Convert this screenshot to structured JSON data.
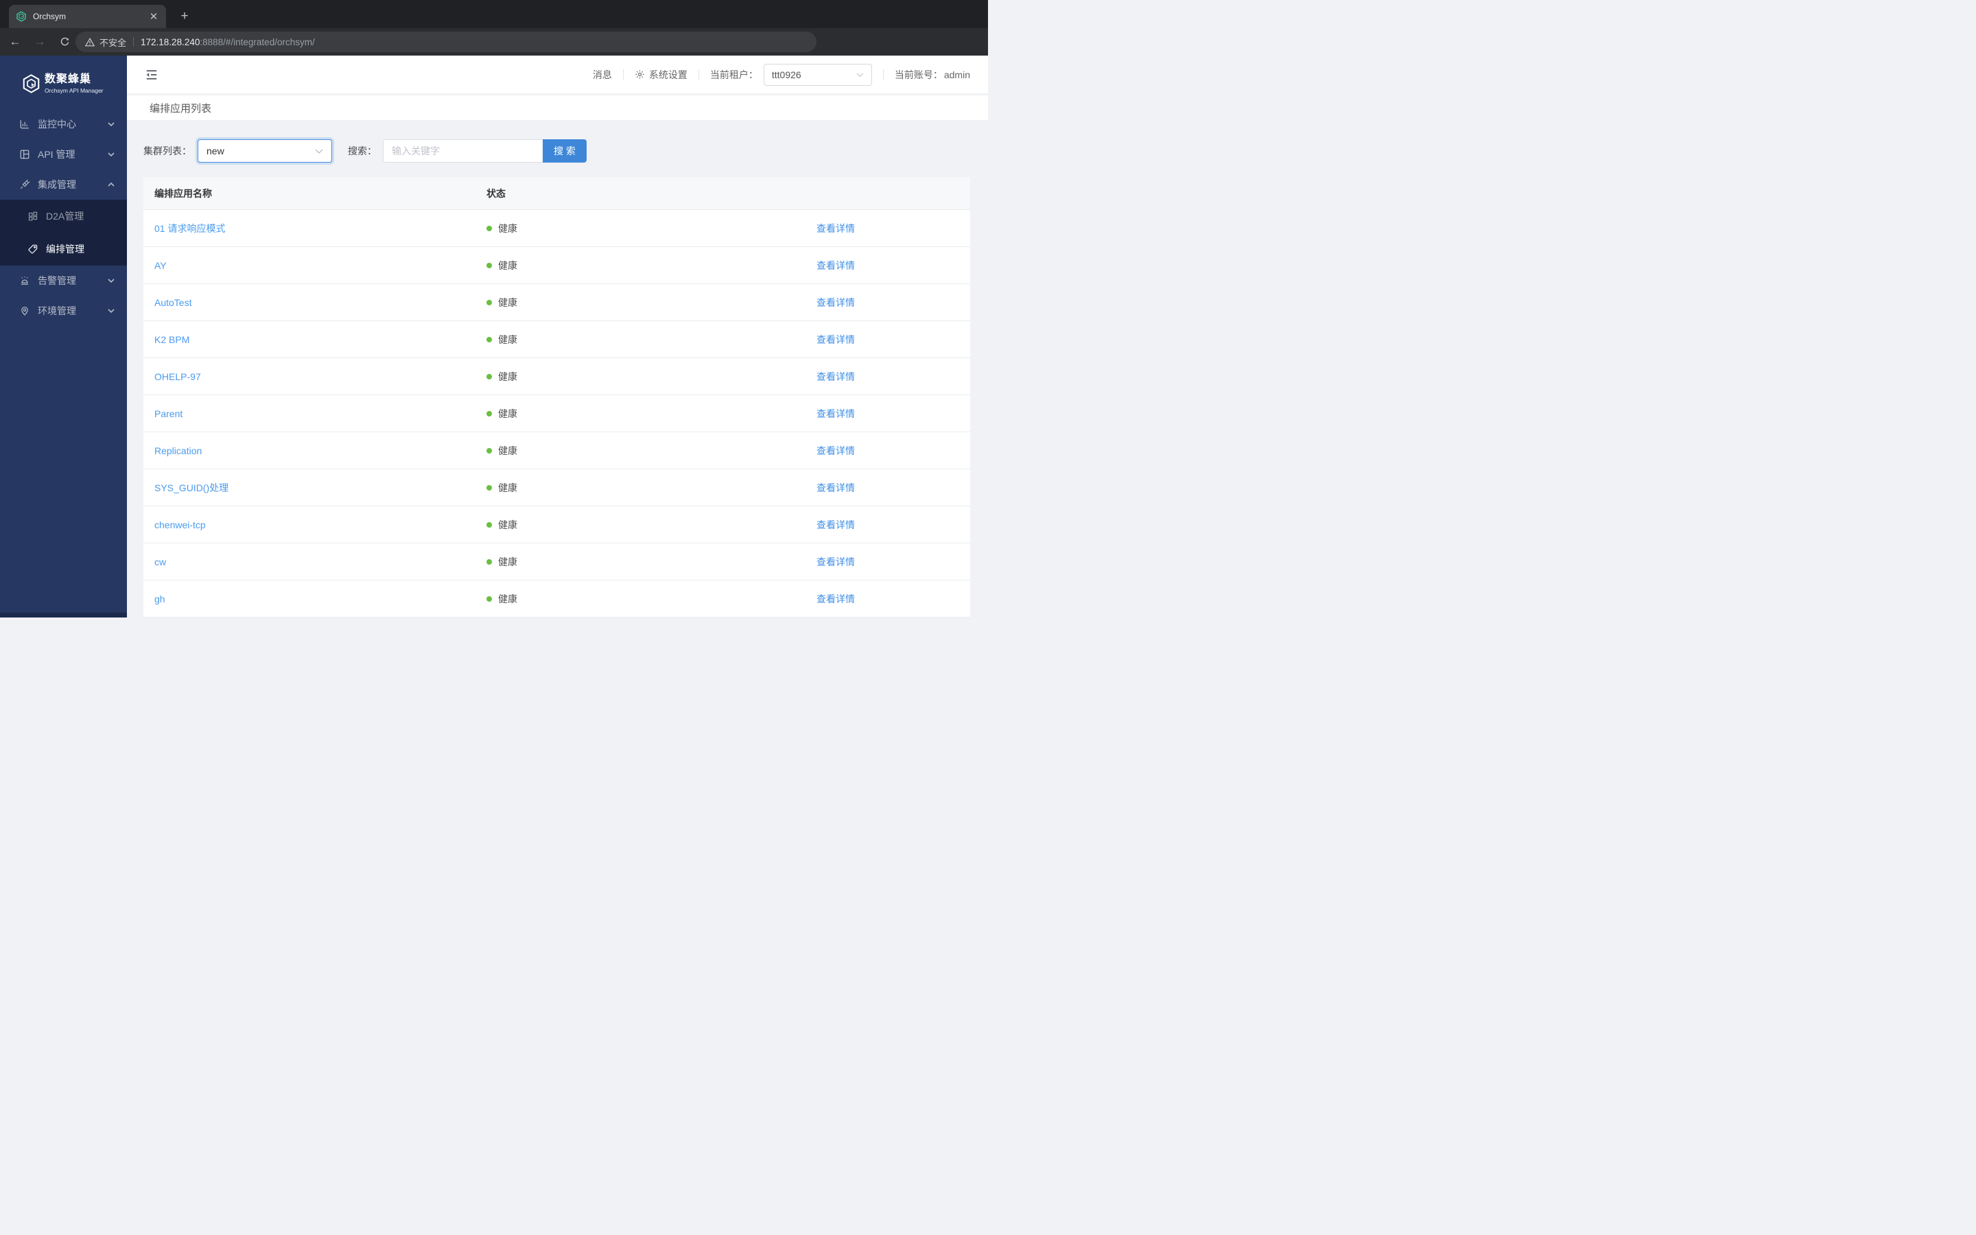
{
  "browser": {
    "tab_title": "Orchsym",
    "close_label": "✕",
    "new_tab_label": "+",
    "security_text": "不安全",
    "url_host": "172.18.28.240",
    "url_rest": ":8888/#/integrated/orchsym/"
  },
  "sidebar": {
    "brand_title": "数聚蜂巢",
    "brand_subtitle": "Orchsym API Manager",
    "menu": [
      {
        "label": "监控中心",
        "icon": "bar-chart-icon",
        "chevron": "down"
      },
      {
        "label": "API 管理",
        "icon": "layout-icon",
        "chevron": "down"
      },
      {
        "label": "集成管理",
        "icon": "plug-icon",
        "chevron": "up",
        "expanded": true
      },
      {
        "label": "D2A管理",
        "icon": "grid-icon"
      },
      {
        "label": "编排管理",
        "icon": "tag-icon",
        "active": true
      },
      {
        "label": "告警管理",
        "icon": "alarm-icon",
        "chevron": "down"
      },
      {
        "label": "环境管理",
        "icon": "map-pin-icon",
        "chevron": "down"
      }
    ]
  },
  "header": {
    "messages_label": "消息",
    "settings_label": "系统设置",
    "tenant_label": "当前租户：",
    "tenant_value": "ttt0926",
    "account_label": "当前账号：",
    "account_value": "admin"
  },
  "page": {
    "title": "编排应用列表"
  },
  "filters": {
    "cluster_label": "集群列表：",
    "cluster_value": "new",
    "search_label": "搜索：",
    "search_placeholder": "输入关键字",
    "search_button": "搜 索"
  },
  "table": {
    "columns": [
      "编排应用名称",
      "状态"
    ],
    "rows": [
      {
        "name": "01 请求响应模式",
        "status": "健康",
        "action": "查看详情"
      },
      {
        "name": "AY",
        "status": "健康",
        "action": "查看详情"
      },
      {
        "name": "AutoTest",
        "status": "健康",
        "action": "查看详情"
      },
      {
        "name": "K2 BPM",
        "status": "健康",
        "action": "查看详情"
      },
      {
        "name": "OHELP-97",
        "status": "健康",
        "action": "查看详情"
      },
      {
        "name": "Parent",
        "status": "健康",
        "action": "查看详情"
      },
      {
        "name": "Replication",
        "status": "健康",
        "action": "查看详情"
      },
      {
        "name": "SYS_GUID()处理",
        "status": "健康",
        "action": "查看详情"
      },
      {
        "name": "chenwei-tcp",
        "status": "健康",
        "action": "查看详情"
      },
      {
        "name": "cw",
        "status": "健康",
        "action": "查看详情"
      },
      {
        "name": "gh",
        "status": "健康",
        "action": "查看详情"
      }
    ]
  },
  "colors": {
    "sidebar_navy": "#263761",
    "submenu_dark": "#18223f",
    "link_blue": "#4b9bee",
    "action_blue": "#3f8fe8",
    "button_blue": "#3e87d8",
    "healthy_green": "#6abf40",
    "favicon_green": "#3ec99e"
  }
}
